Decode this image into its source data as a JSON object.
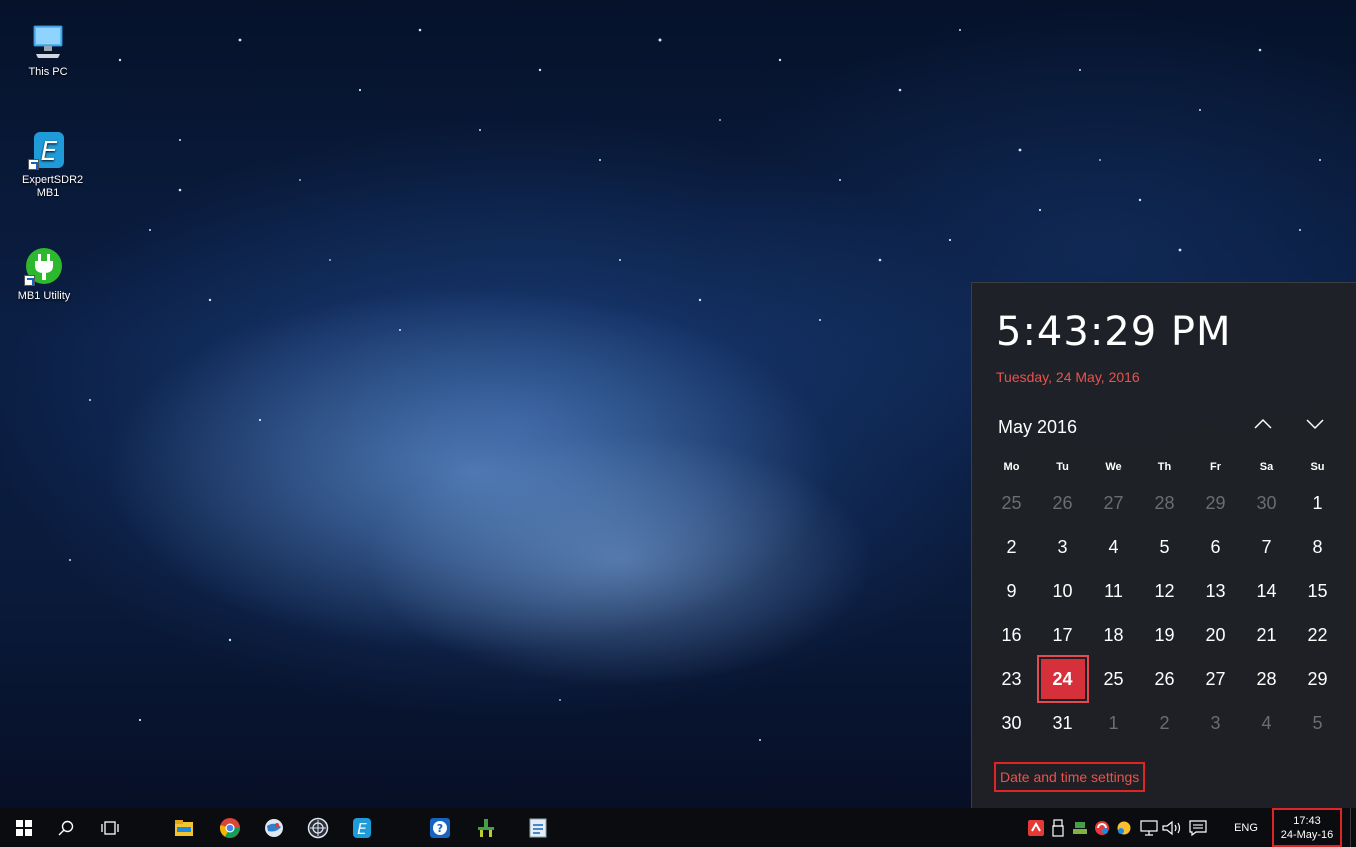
{
  "desktop": {
    "icons": [
      {
        "label": "This PC",
        "icon": "computer-icon"
      },
      {
        "label": "ExpertSDR2 MB1",
        "icon": "expertsdr-icon"
      },
      {
        "label": "MB1 Utility",
        "icon": "plug-icon"
      }
    ]
  },
  "calendar_flyout": {
    "time": "5:43:29 PM",
    "long_date": "Tuesday, 24 May, 2016",
    "month_label": "May 2016",
    "prev_icon": "chevron-up-icon",
    "next_icon": "chevron-down-icon",
    "weekdays": [
      "Mo",
      "Tu",
      "We",
      "Th",
      "Fr",
      "Sa",
      "Su"
    ],
    "weeks": [
      [
        "25",
        "26",
        "27",
        "28",
        "29",
        "30",
        "1"
      ],
      [
        "2",
        "3",
        "4",
        "5",
        "6",
        "7",
        "8"
      ],
      [
        "9",
        "10",
        "11",
        "12",
        "13",
        "14",
        "15"
      ],
      [
        "16",
        "17",
        "18",
        "19",
        "20",
        "21",
        "22"
      ],
      [
        "23",
        "24",
        "25",
        "26",
        "27",
        "28",
        "29"
      ],
      [
        "30",
        "31",
        "1",
        "2",
        "3",
        "4",
        "5"
      ]
    ],
    "selected_day": "24",
    "settings_link": "Date and time settings",
    "accent_color": "#d6303a"
  },
  "taskbar": {
    "pinned": [
      {
        "name": "start",
        "icon": "windows-logo-icon"
      },
      {
        "name": "search",
        "icon": "search-icon"
      },
      {
        "name": "task-view",
        "icon": "task-view-icon"
      },
      {
        "name": "file-explorer",
        "icon": "folder-icon"
      },
      {
        "name": "chrome",
        "icon": "chrome-icon"
      },
      {
        "name": "app-globe",
        "icon": "globe-app-icon"
      },
      {
        "name": "app-ball",
        "icon": "ball-app-icon"
      },
      {
        "name": "expertsdr",
        "icon": "expertsdr-icon"
      },
      {
        "name": "help",
        "icon": "help-app-icon"
      },
      {
        "name": "app-green",
        "icon": "green-app-icon"
      },
      {
        "name": "app-doc",
        "icon": "document-app-icon"
      }
    ],
    "tray": {
      "icons": [
        "antivirus-icon",
        "usb-icon",
        "green-tray-icon",
        "update-icon",
        "yellow-tray-icon",
        "network-icon",
        "volume-icon",
        "notifications-icon"
      ],
      "language": "ENG",
      "clock_time": "17:43",
      "clock_date": "24-May-16"
    }
  }
}
